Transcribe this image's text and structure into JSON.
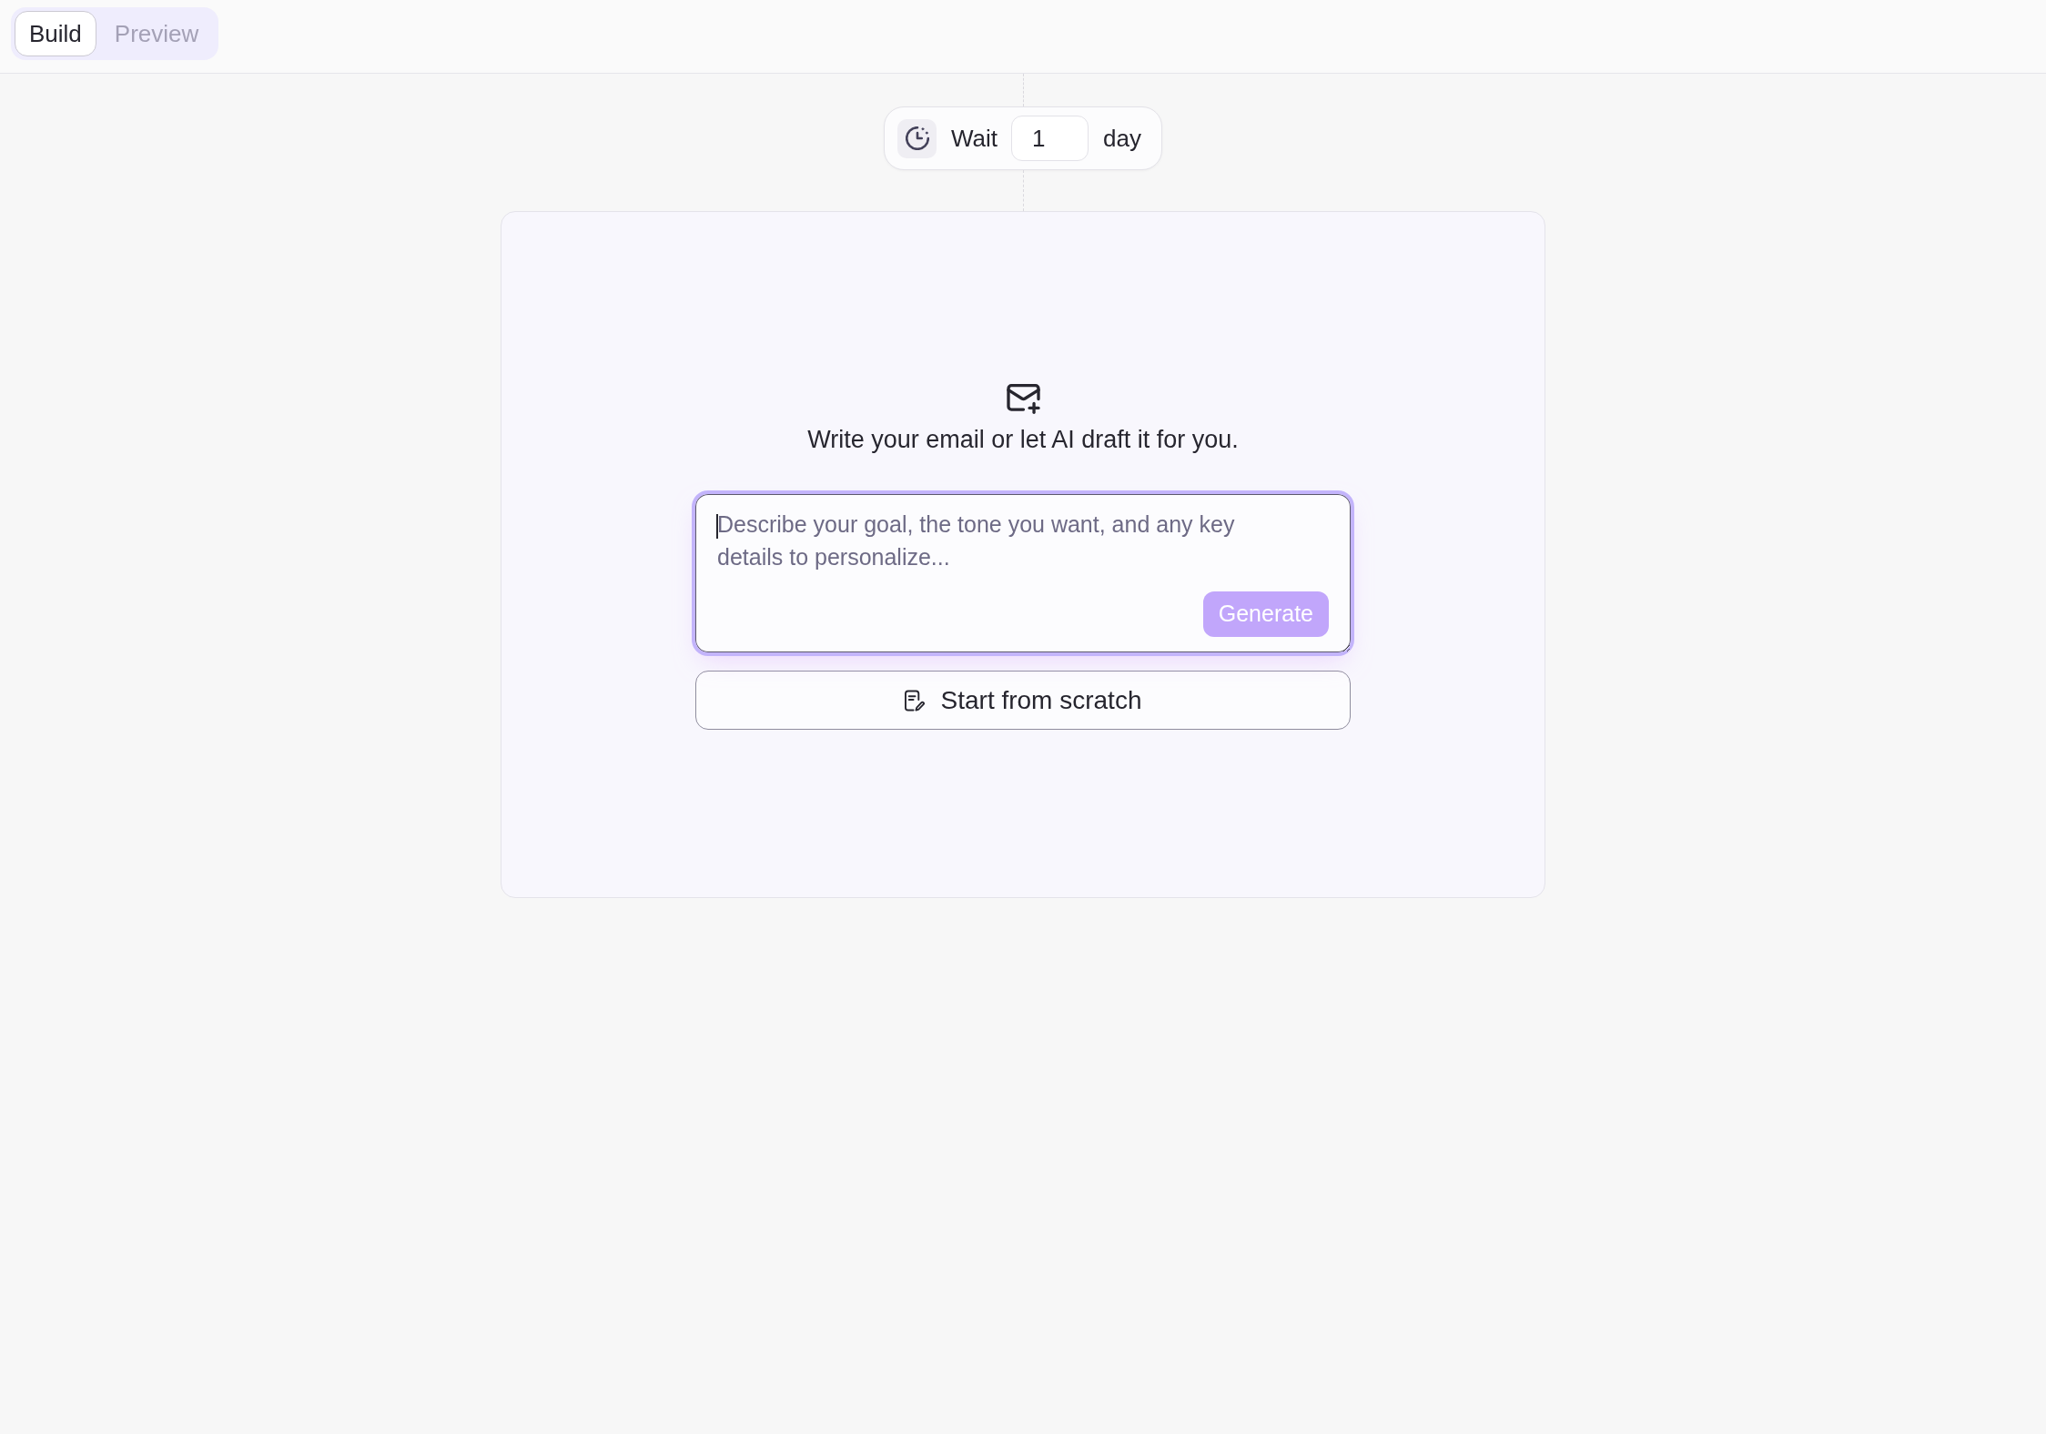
{
  "header": {
    "tabs": [
      {
        "label": "Build",
        "selected": true
      },
      {
        "label": "Preview",
        "selected": false
      }
    ]
  },
  "wait_step": {
    "label": "Wait",
    "value": "1",
    "unit": "day"
  },
  "email_step": {
    "prompt": "Write your email or let AI draft it for you.",
    "ai_input": {
      "placeholder": "Describe your goal, the tone you want, and any key details to personalize...",
      "focused": true
    },
    "generate_button": {
      "label": "Generate",
      "disabled": true
    },
    "scratch_button": {
      "label": "Start from scratch"
    }
  }
}
